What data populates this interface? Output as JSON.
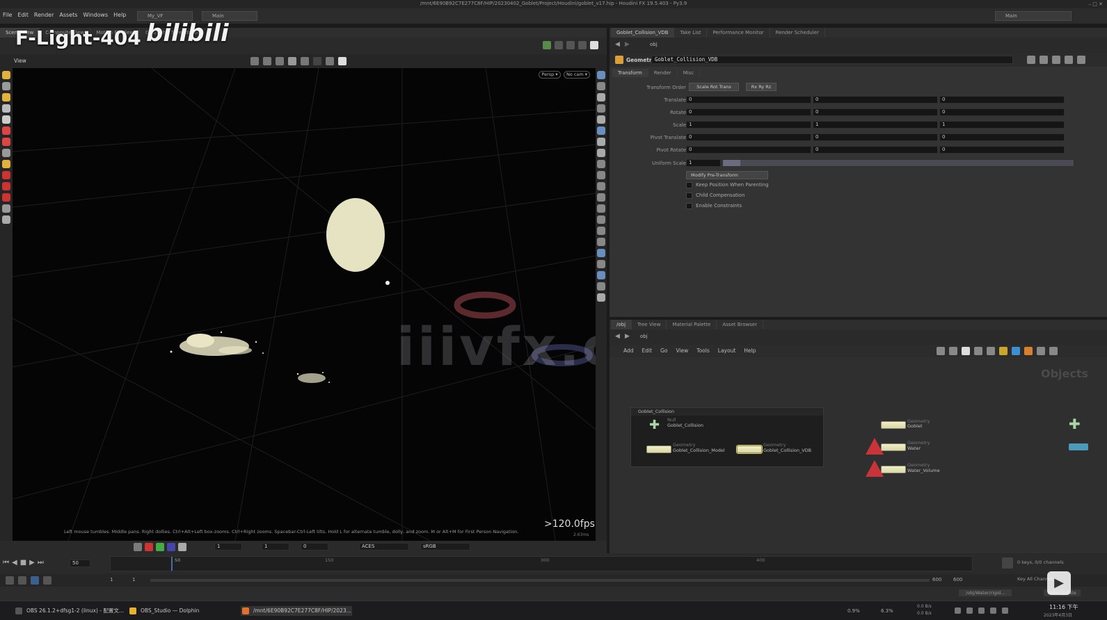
{
  "window": {
    "title": "/mnt/6E90B92C7E277C8F/HIP/20230402_Goblet/Project/Houdini/goblet_v17.hip - Houdini FX 19.5.403 - Py3.9"
  },
  "menu": {
    "items": [
      "File",
      "Edit",
      "Render",
      "Assets",
      "Windows",
      "Help"
    ],
    "desktop": "My_VF",
    "desk_main": "Main",
    "right_main": "Main"
  },
  "overlay": {
    "channel": "F-Light-404",
    "brand": "bilibili",
    "watermark": "iiivfx.com"
  },
  "left_panel": {
    "tabs": [
      "Scene View",
      "Composite View",
      "Motion FX View",
      "Geometry Spreadsheet"
    ],
    "view_label": "View",
    "persp": "Persp ▾",
    "nocam": "No cam ▾",
    "fps": ">120.0fps",
    "fps_sub": "2.63ms",
    "help_text": "Left mouse tumbles. Middle pans. Right dollies. Ctrl+Alt+Left box-zooms. Ctrl+Right zooms. Spacebar-Ctrl-Left tilts. Hold L for alternate tumble, dolly, and zoom.    M or Alt+M for First Person Navigation."
  },
  "viewport_bottom": {
    "field1": "1",
    "field2": "1",
    "field3": "0",
    "cam_res": "ACES",
    "view_transform": "sRGB"
  },
  "params": {
    "tabs": [
      "Goblet_Collision_VDB",
      "Take List",
      "Performance Monitor",
      "Render Scheduler"
    ],
    "path": "obj",
    "node_type": "Geometry",
    "node_name": "Goblet_Collision_VDB",
    "subtabs": [
      "Transform",
      "Render",
      "Misc"
    ],
    "transform_order_label": "Transform Order",
    "transform_order": "Scale Rot Trans",
    "rot_order": "Rx Ry Rz",
    "rows": [
      {
        "label": "Translate",
        "x": "0",
        "y": "0",
        "z": "0"
      },
      {
        "label": "Rotate",
        "x": "0",
        "y": "0",
        "z": "0"
      },
      {
        "label": "Scale",
        "x": "1",
        "y": "1",
        "z": "1"
      },
      {
        "label": "Pivot Translate",
        "x": "0",
        "y": "0",
        "z": "0"
      },
      {
        "label": "Pivot Rotate",
        "x": "0",
        "y": "0",
        "z": "0"
      }
    ],
    "uniform_label": "Uniform Scale",
    "uniform_value": "1",
    "uniform_fraction": 0.05,
    "modify_pre": "Modify Pre-Transform",
    "checkboxes": [
      "Keep Position When Parenting",
      "Child Compensation",
      "Enable Constraints"
    ]
  },
  "network": {
    "tabs": [
      "/obj",
      "Tree View",
      "Material Palette",
      "Asset Browser"
    ],
    "path": "obj",
    "menu": [
      "Add",
      "Edit",
      "Go",
      "View",
      "Tools",
      "Layout",
      "Help"
    ],
    "context": "Objects",
    "box_title": "Goblet_Collision",
    "nodes": {
      "null_name": "Goblet_Collision",
      "null_type": "Null",
      "model_name": "Goblet_Collision_Model",
      "model_type": "Geometry",
      "vdb_name": "Goblet_Collision_VDB",
      "vdb_type": "Geometry",
      "goblet": "Goblet",
      "goblet_type": "Geometry",
      "water": "Water",
      "water_type": "Geometry",
      "wv": "Water_Volume",
      "wv_type": "Geometry"
    }
  },
  "timeline": {
    "frame": "50",
    "start": "1",
    "start2": "1",
    "end": "600",
    "end2": "600",
    "ticks": [
      "50",
      "150",
      "300",
      "400"
    ],
    "keys": "0 keys, 0/0 channels",
    "key_all": "Key All Channels",
    "auto_update": "Auto Update",
    "status": "/obj/Water/rigid...",
    "playhead_fraction": 0.07
  },
  "taskbar": {
    "items": [
      "OBS 26.1.2+dfsg1-2 (linux) - 配置文...",
      "OBS_Studio — Dolphin",
      "/mnt/6E90B92C7E277C8F/HIP/2023..."
    ],
    "cpu": "0.9%",
    "mem": "6.3%",
    "net_up": "0.0 B/s",
    "net_down": "0.0 B/s",
    "clock": "11:16 下午",
    "date": "2023年4月3日"
  },
  "colors": {
    "node": "#e8e6b8",
    "accent": "#3f6fb5",
    "warn": "#d03a3a"
  }
}
